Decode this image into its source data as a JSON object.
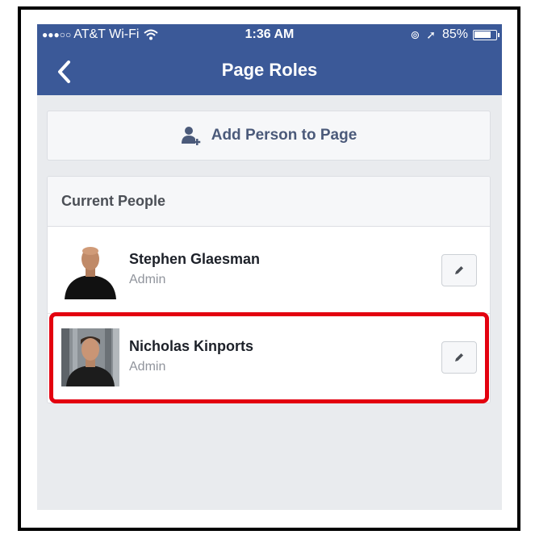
{
  "status_bar": {
    "signal": "●●●○○",
    "carrier": "AT&T Wi-Fi",
    "time": "1:36 AM",
    "battery_percent_label": "85%",
    "battery_level": 0.85,
    "icons": [
      "wifi-icon",
      "orientation-lock-icon",
      "location-arrow-icon",
      "battery-icon"
    ]
  },
  "nav": {
    "title": "Page Roles",
    "back_icon": "chevron-left-icon"
  },
  "add_person": {
    "label": "Add Person to Page",
    "icon": "add-person-icon"
  },
  "people_section": {
    "title": "Current People",
    "people": [
      {
        "name": "Stephen Glaesman",
        "role": "Admin",
        "edit_icon": "pencil-icon"
      },
      {
        "name": "Nicholas Kinports",
        "role": "Admin",
        "edit_icon": "pencil-icon",
        "highlighted": true
      }
    ]
  },
  "colors": {
    "navbar": "#3b5998",
    "background": "#e9ebee",
    "highlight": "#e3000f",
    "frame": "#000000"
  }
}
